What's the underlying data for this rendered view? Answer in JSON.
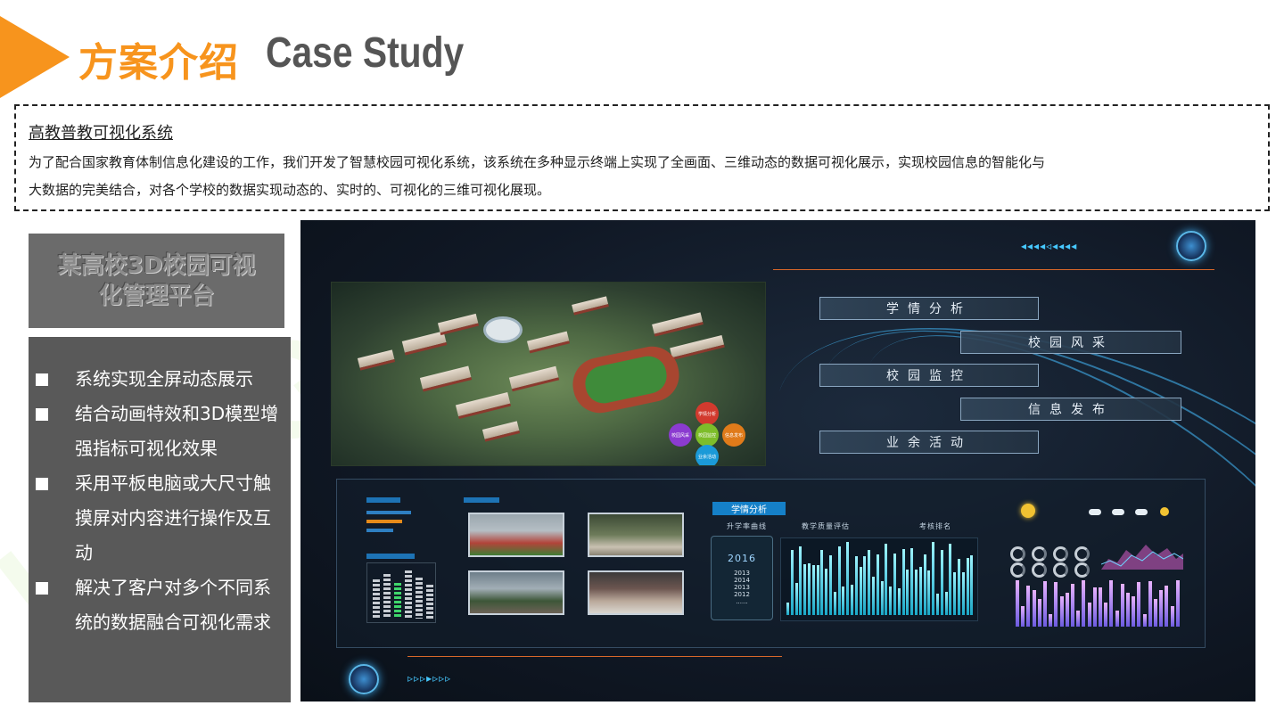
{
  "header": {
    "title_cn": "方案介绍",
    "title_en": "Case Study"
  },
  "intro": {
    "title": "高教普教可视化系统",
    "line1": "为了配合国家教育体制信息化建设的工作，我们开发了智慧校园可视化系统，该系统在多种显示终端上实现了全画面、三维动态的数据可视化展示，实现校园信息的智能化与",
    "line2": "大数据的完美结合，对各个学校的数据实现动态的、实时的、可视化的三维可视化展现。"
  },
  "platform": {
    "title_line1": "某高校3D校园可视",
    "title_line2": "化管理平台"
  },
  "features": [
    "系统实现全屏动态展示",
    "结合动画特效和3D模型增强指标可视化效果",
    "采用平板电脑或大尺寸触摸屏对内容进行操作及互动",
    "解决了客户对多个不同系统的数据融合可视化需求"
  ],
  "dashboard": {
    "menu": [
      "学情分析",
      "校园风采",
      "校园监控",
      "信息发布",
      "业余活动"
    ],
    "analysis_tab": "学情分析",
    "analysis_labels": [
      "升学率曲线",
      "教学质量评估",
      "考核排名"
    ],
    "year_current": "2016",
    "years": [
      "2013",
      "2014",
      "2013",
      "2012",
      "......"
    ],
    "orb_circles": [
      "学情分析",
      "校园监控",
      "信息发布",
      "业余活动",
      "校园风采"
    ]
  },
  "colors": {
    "accent": "#f7941d",
    "title_gray": "#555555",
    "panel_dark": "#595959",
    "panel_mid": "#6b6b6b",
    "dash_bg": "#101825"
  }
}
